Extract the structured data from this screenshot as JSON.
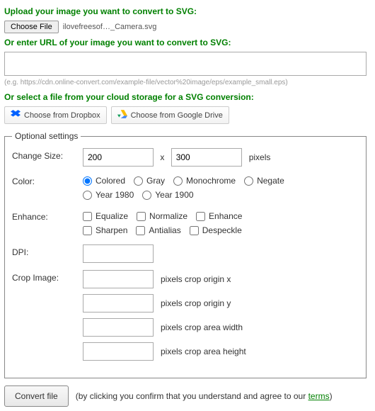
{
  "section_upload_title": "Upload your image you want to convert to SVG:",
  "choose_file_label": "Choose File",
  "file_name": "ilovefreesof…_Camera.svg",
  "section_url_title": "Or enter URL of your image you want to convert to SVG:",
  "url_value": "",
  "url_example": "(e.g. https://cdn.online-convert.com/example-file/vector%20image/eps/example_small.eps)",
  "section_cloud_title": "Or select a file from your cloud storage for a SVG conversion:",
  "cloud": {
    "dropbox": "Choose from Dropbox",
    "gdrive": "Choose from Google Drive"
  },
  "optional_legend": "Optional settings",
  "labels": {
    "change_size": "Change Size:",
    "color": "Color:",
    "enhance": "Enhance:",
    "dpi": "DPI:",
    "crop": "Crop Image:"
  },
  "size": {
    "width": "200",
    "x": "x",
    "height": "300",
    "unit": "pixels"
  },
  "color_options": {
    "colored": "Colored",
    "gray": "Gray",
    "monochrome": "Monochrome",
    "negate": "Negate",
    "year1980": "Year 1980",
    "year1900": "Year 1900"
  },
  "enhance_options": {
    "equalize": "Equalize",
    "normalize": "Normalize",
    "enhance": "Enhance",
    "sharpen": "Sharpen",
    "antialias": "Antialias",
    "despeckle": "Despeckle"
  },
  "dpi_value": "",
  "crop": {
    "ox_value": "",
    "ox_label": "pixels crop origin x",
    "oy_value": "",
    "oy_label": "pixels crop origin y",
    "w_value": "",
    "w_label": "pixels crop area width",
    "h_value": "",
    "h_label": "pixels crop area height"
  },
  "convert_label": "Convert file",
  "confirm_prefix": "(by clicking you confirm that you understand and agree to our ",
  "confirm_link": "terms",
  "confirm_suffix": ")"
}
